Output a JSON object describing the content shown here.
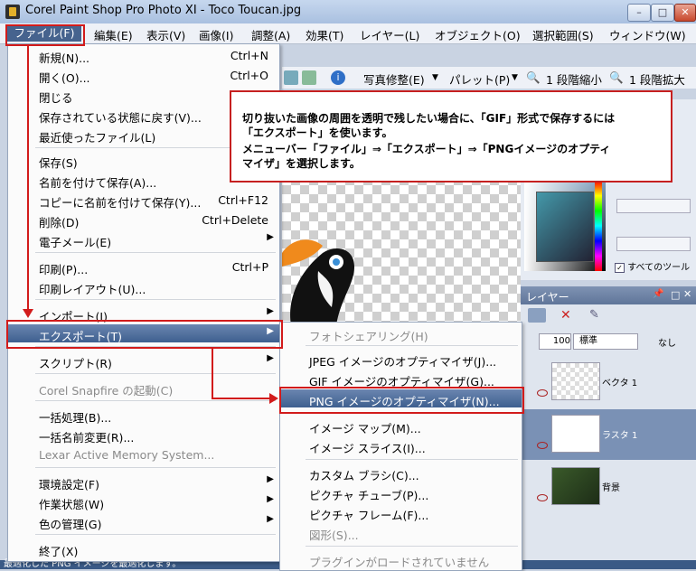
{
  "window": {
    "title": "Corel Paint Shop Pro Photo XI - Toco Toucan.jpg",
    "min_glyph": "–",
    "max_glyph": "□",
    "close_glyph": "✕"
  },
  "menubar": {
    "items": [
      {
        "label": "ファイル(F)"
      },
      {
        "label": "編集(E)"
      },
      {
        "label": "表示(V)"
      },
      {
        "label": "画像(I)"
      },
      {
        "label": "調整(A)"
      },
      {
        "label": "効果(T)"
      },
      {
        "label": "レイヤー(L)"
      },
      {
        "label": "オブジェクト(O)"
      },
      {
        "label": "選択範囲(S)"
      },
      {
        "label": "ウィンドウ(W)"
      }
    ]
  },
  "toolbar": {
    "photo_fix": "写真修整(E)",
    "palette": "パレット(P)",
    "zoom_out": "1 段階縮小",
    "zoom_in": "1 段階拡大"
  },
  "file_menu": {
    "items": [
      {
        "label": "新規(N)...",
        "shortcut": "Ctrl+N"
      },
      {
        "label": "開く(O)...",
        "shortcut": "Ctrl+O"
      },
      {
        "label": "閉じる",
        "shortcut": ""
      },
      {
        "label": "保存されている状態に戻す(V)...",
        "shortcut": ""
      },
      {
        "label": "最近使ったファイル(L)",
        "shortcut": ""
      },
      {
        "label": "保存(S)",
        "shortcut": ""
      },
      {
        "label": "名前を付けて保存(A)...",
        "shortcut": ""
      },
      {
        "label": "コピーに名前を付けて保存(Y)...",
        "shortcut": "Ctrl+F12"
      },
      {
        "label": "削除(D)",
        "shortcut": "Ctrl+Delete"
      },
      {
        "label": "電子メール(E)",
        "shortcut": ""
      },
      {
        "label": "印刷(P)...",
        "shortcut": "Ctrl+P"
      },
      {
        "label": "印刷レイアウト(U)...",
        "shortcut": ""
      },
      {
        "label": "インポート(I)",
        "shortcut": ""
      },
      {
        "label": "エクスポート(T)",
        "shortcut": ""
      },
      {
        "label": "スクリプト(R)",
        "shortcut": ""
      },
      {
        "label": "Corel Snapfire の起動(C)",
        "shortcut": ""
      },
      {
        "label": "一括処理(B)...",
        "shortcut": ""
      },
      {
        "label": "一括名前変更(R)...",
        "shortcut": ""
      },
      {
        "label": "Lexar Active Memory System...",
        "shortcut": ""
      },
      {
        "label": "環境設定(F)",
        "shortcut": ""
      },
      {
        "label": "作業状態(W)",
        "shortcut": ""
      },
      {
        "label": "色の管理(G)",
        "shortcut": ""
      },
      {
        "label": "終了(X)",
        "shortcut": ""
      }
    ]
  },
  "export_submenu": {
    "items": [
      {
        "label": "フォトシェアリング(H)"
      },
      {
        "label": "JPEG イメージのオプティマイザ(J)..."
      },
      {
        "label": "GIF イメージのオプティマイザ(G)..."
      },
      {
        "label": "PNG イメージのオプティマイザ(N)..."
      },
      {
        "label": "イメージ マップ(M)..."
      },
      {
        "label": "イメージ スライス(I)..."
      },
      {
        "label": "カスタム ブラシ(C)..."
      },
      {
        "label": "ピクチャ チューブ(P)..."
      },
      {
        "label": "ピクチャ フレーム(F)..."
      },
      {
        "label": "図形(S)..."
      },
      {
        "label": "プラグインがロードされていません"
      }
    ]
  },
  "callout": {
    "line1": "切り抜いた画像の周囲を透明で残したい場合に、「GIF」形式で保存するには",
    "line2": "「エクスポート」を使います。",
    "line3": "メニューバー「ファイル」⇒「エクスポート」⇒「PNGイメージのオプティ",
    "line4": "マイザ」を選択します。"
  },
  "right_panel": {
    "all_tools": "すべてのツール",
    "layers_title": "レイヤー",
    "opacity": "100",
    "blend_mode": "標準",
    "none_label": "なし",
    "layers": [
      {
        "name": "ベクタ 1"
      },
      {
        "name": "ラスタ 1"
      },
      {
        "name": "背景"
      }
    ]
  },
  "status": {
    "text": "最適化した PNG イメージを最適化します。"
  },
  "colors": {
    "highlight_red": "#d21b1b",
    "menu_highlight": "#3e5f8f"
  }
}
